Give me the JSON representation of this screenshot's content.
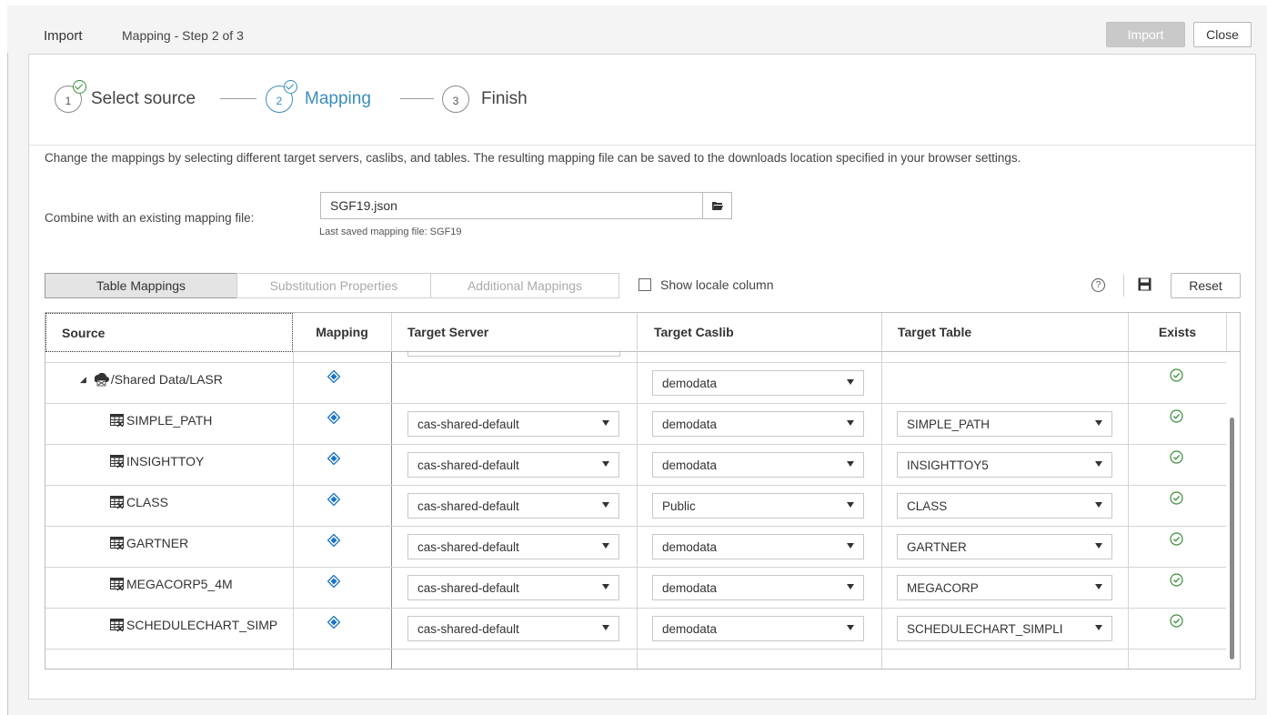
{
  "titlebar": {
    "app_label": "Import",
    "step_title": "Mapping - Step 2 of 3",
    "import_button": "Import",
    "close_button": "Close"
  },
  "stepper": {
    "steps": [
      {
        "number": "1",
        "label": "Select source",
        "state": "complete"
      },
      {
        "number": "2",
        "label": "Mapping",
        "state": "active"
      },
      {
        "number": "3",
        "label": "Finish",
        "state": "pending"
      }
    ]
  },
  "description": "Change the mappings by selecting different target servers, caslibs, and tables. The resulting mapping file can be saved to the downloads location specified in your browser settings.",
  "combine": {
    "label": "Combine with an existing mapping file:",
    "file_value": "SGF19.json",
    "last_saved": "Last saved mapping file: SGF19"
  },
  "tabs": [
    "Table Mappings",
    "Substitution Properties",
    "Additional Mappings"
  ],
  "show_locale_label": "Show locale column",
  "reset_button": "Reset",
  "columns": [
    "Source",
    "Mapping",
    "Target Server",
    "Target Caslib",
    "Target Table",
    "Exists"
  ],
  "rows": [
    {
      "source": "/Shared Data/LASR",
      "type": "folder",
      "server": "",
      "caslib": "demodata",
      "table": ""
    },
    {
      "source": "SIMPLE_PATH",
      "type": "table",
      "server": "cas-shared-default",
      "caslib": "demodata",
      "table": "SIMPLE_PATH"
    },
    {
      "source": "INSIGHTTOY",
      "type": "table",
      "server": "cas-shared-default",
      "caslib": "demodata",
      "table": "INSIGHTTOY5"
    },
    {
      "source": "CLASS",
      "type": "table",
      "server": "cas-shared-default",
      "caslib": "Public",
      "table": "CLASS"
    },
    {
      "source": "GARTNER",
      "type": "table",
      "server": "cas-shared-default",
      "caslib": "demodata",
      "table": "GARTNER"
    },
    {
      "source": "MEGACORP5_4M",
      "type": "table",
      "server": "cas-shared-default",
      "caslib": "demodata",
      "table": "MEGACORP"
    },
    {
      "source": "SCHEDULECHART_SIMP",
      "type": "table",
      "server": "cas-shared-default",
      "caslib": "demodata",
      "table": "SCHEDULECHART_SIMPLI"
    }
  ],
  "colors": {
    "accent": "#3a8dbd",
    "success": "#3a8d3a",
    "mapping_icon": "#1a73c8"
  }
}
